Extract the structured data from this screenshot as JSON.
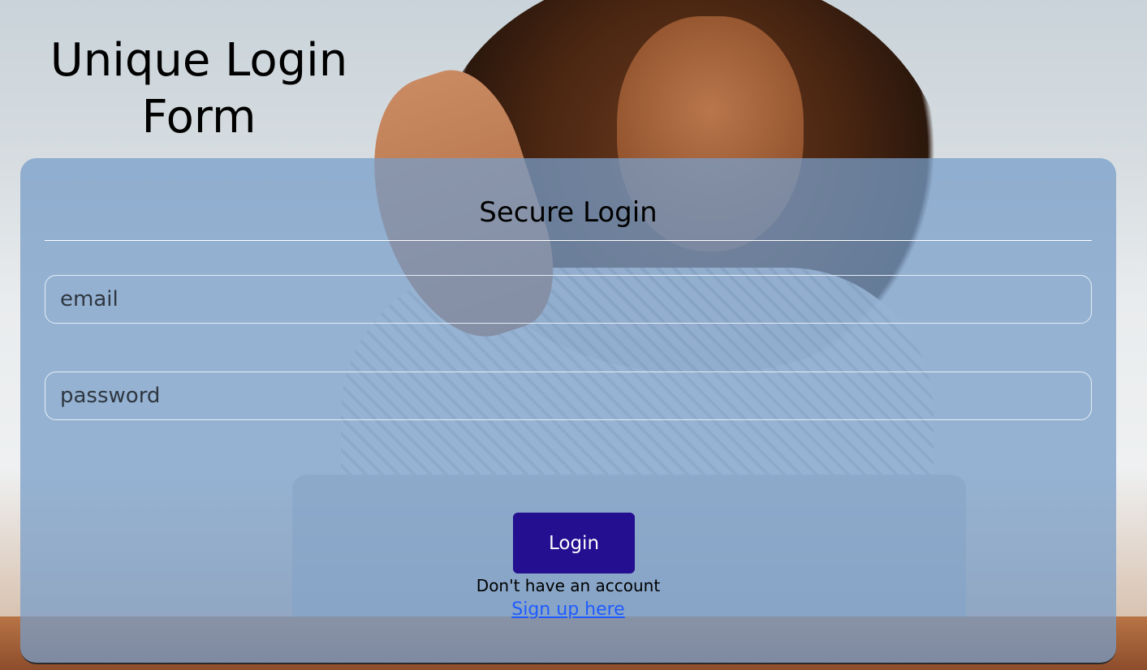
{
  "page": {
    "title": "Unique Login Form"
  },
  "form": {
    "heading": "Secure Login",
    "email": {
      "placeholder": "email",
      "value": ""
    },
    "password": {
      "placeholder": "password",
      "value": ""
    },
    "login_label": "Login",
    "signup_prompt": "Don't have an account",
    "signup_link_label": "Sign up here"
  },
  "colors": {
    "card_background": "#789dc8",
    "login_button": "#230f8f",
    "link": "#1e5bff",
    "divider": "#ffffff"
  },
  "background_image": "woman-with-laptop-photo"
}
